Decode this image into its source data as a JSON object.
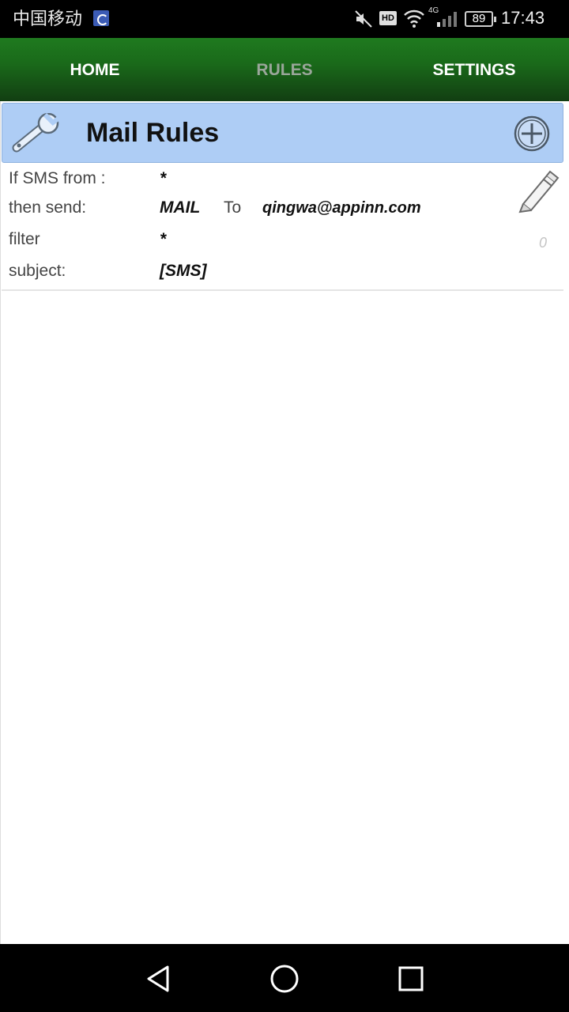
{
  "status_bar": {
    "carrier": "中国移动",
    "network": "4G",
    "battery": "89",
    "time": "17:43",
    "hd": "HD"
  },
  "tabs": [
    {
      "label": "HOME",
      "active": false
    },
    {
      "label": "RULES",
      "active": true
    },
    {
      "label": "SETTINGS",
      "active": false
    }
  ],
  "header": {
    "title": "Mail Rules",
    "left_icon": "wrench-icon",
    "right_icon": "add-circle-icon"
  },
  "rule": {
    "from_label": "If SMS from :",
    "from_value": "*",
    "send_label": "then send:",
    "send_value": "MAIL",
    "to_label": "To",
    "to_value": "qingwa@appinn.com",
    "filter_label": "filter",
    "filter_value": "*",
    "subject_label": "subject:",
    "subject_value": "[SMS]",
    "count": "0",
    "edit_icon": "pencil-icon"
  },
  "nav": {
    "back_icon": "back-triangle-icon",
    "home_icon": "home-circle-icon",
    "recent_icon": "recent-square-icon"
  },
  "colors": {
    "tab_bar": "#1a6a1a",
    "header_bg": "#aecdf5",
    "inactive_tab": "#9aa69a"
  }
}
